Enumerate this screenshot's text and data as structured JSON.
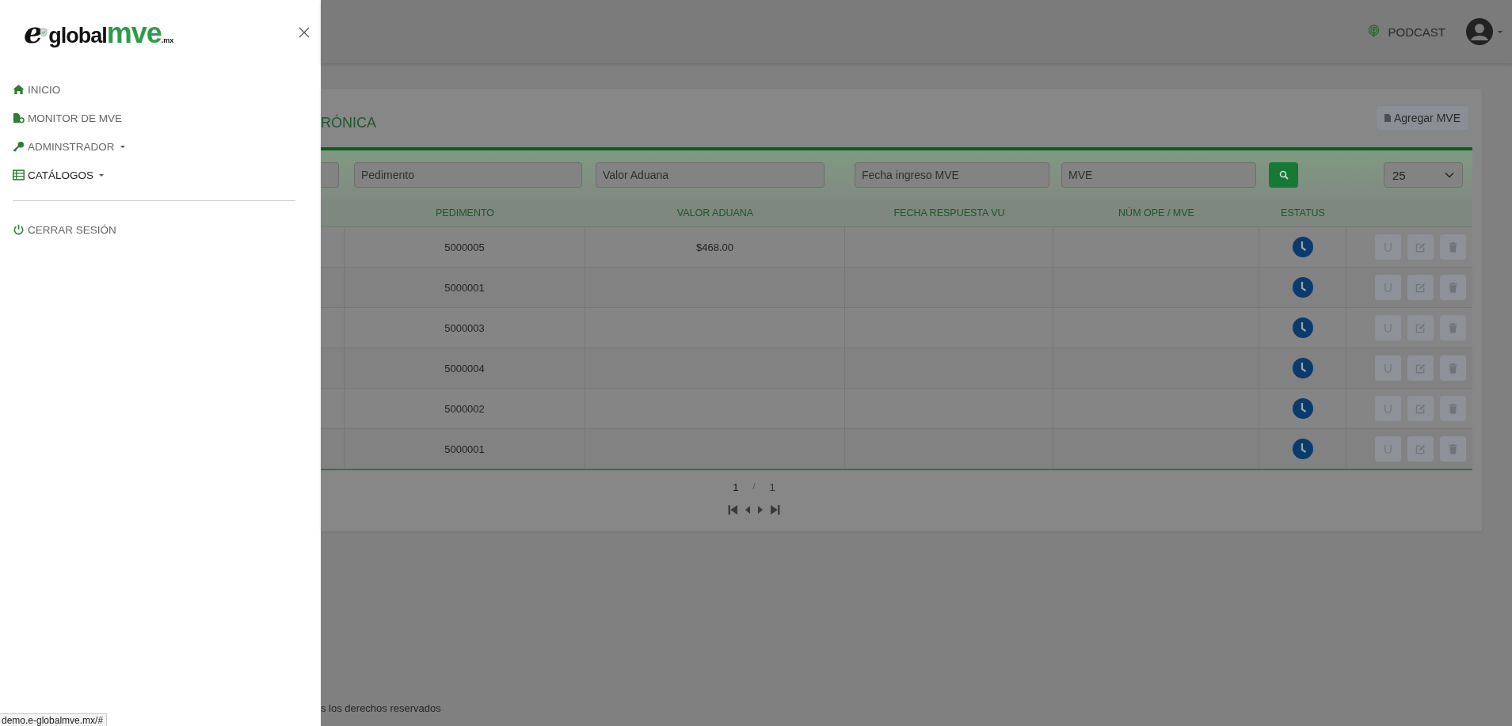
{
  "sidebar": {
    "logo": {
      "mark": "e",
      "word": "global",
      "brand": "mve",
      "suffix": ".mx"
    },
    "items": [
      {
        "label": "INICIO",
        "dropdown": false,
        "selected": false
      },
      {
        "label": "MONITOR DE MVE",
        "dropdown": false,
        "selected": false
      },
      {
        "label": "ADMINSTRADOR",
        "dropdown": true,
        "selected": false
      },
      {
        "label": "CATÁLOGOS",
        "dropdown": true,
        "selected": true
      }
    ],
    "logout": {
      "label": "CERRAR SESIÓN"
    }
  },
  "header": {
    "podcast": "PODCAST"
  },
  "card": {
    "title": "RÓNICA",
    "add_button": "Agregar MVE",
    "filters": [
      {
        "placeholder": "Pedimento"
      },
      {
        "placeholder": "Valor Aduana"
      },
      {
        "placeholder": "Fecha ingreso MVE"
      },
      {
        "placeholder": "MVE"
      }
    ],
    "page_size": "25",
    "columns": [
      {
        "label": "PEDIMENTO"
      },
      {
        "label": "VALOR ADUANA"
      },
      {
        "label": "FECHA RESPUESTA VU"
      },
      {
        "label": "NÚM OPE / MVE"
      },
      {
        "label": "ESTATUS"
      }
    ],
    "rows": [
      {
        "pedimento": "5000005",
        "valor_aduana": "$468.00"
      },
      {
        "pedimento": "5000001"
      },
      {
        "pedimento": "5000003"
      },
      {
        "pedimento": "5000004"
      },
      {
        "pedimento": "5000002"
      },
      {
        "pedimento": "5000001"
      }
    ],
    "pagination": {
      "current": "1",
      "separator": "/",
      "total": "1"
    }
  },
  "footer": {
    "text": "s los derechos reservados"
  },
  "status_url": "demo.e-globalmve.mx/#"
}
